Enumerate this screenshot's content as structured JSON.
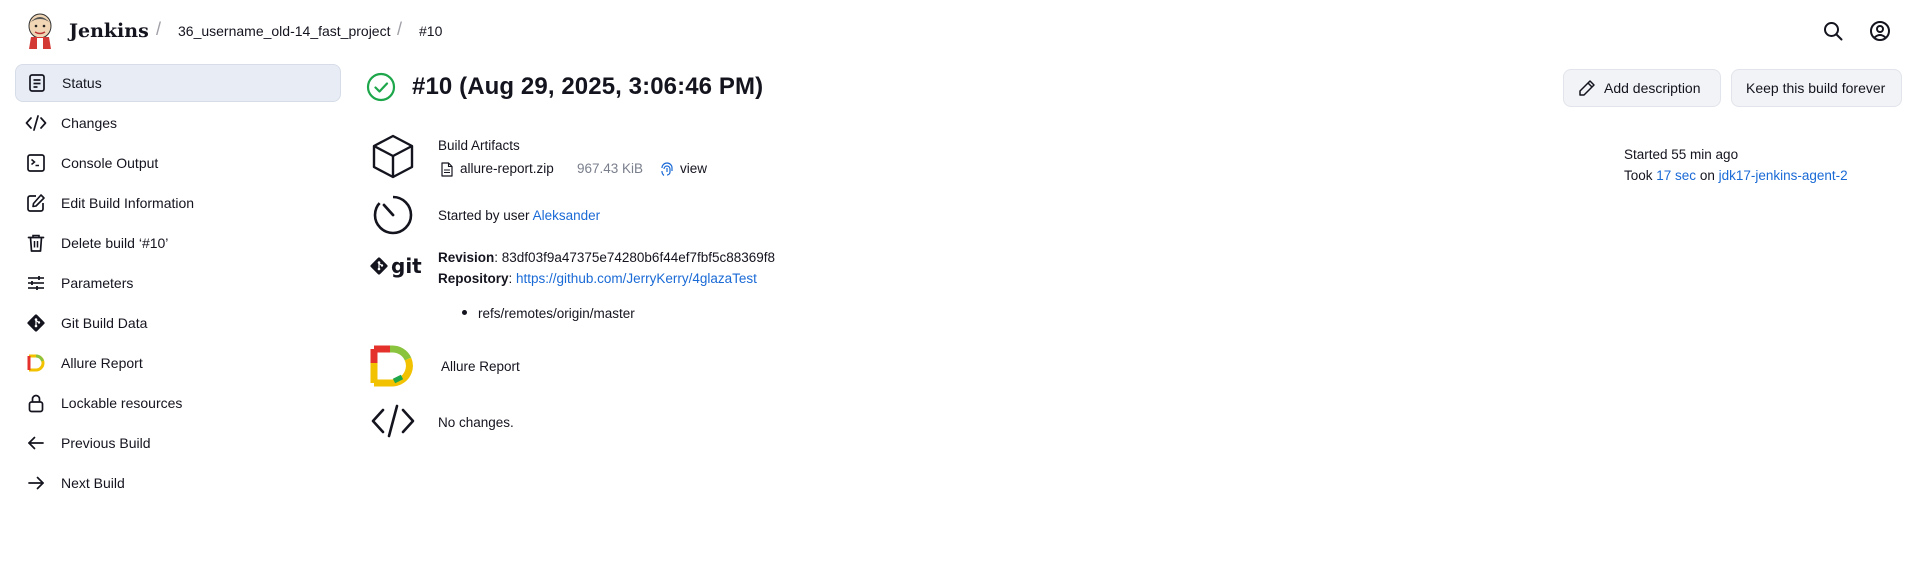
{
  "header": {
    "brand": "Jenkins",
    "breadcrumbs": [
      "36_username_old-14_fast_project",
      "#10"
    ],
    "separator": "/"
  },
  "sidebar": {
    "items": [
      {
        "label": "Status",
        "icon": "document-icon",
        "active": true
      },
      {
        "label": "Changes",
        "icon": "code-icon"
      },
      {
        "label": "Console Output",
        "icon": "terminal-icon"
      },
      {
        "label": "Edit Build Information",
        "icon": "edit-icon"
      },
      {
        "label": "Delete build ‘#10’",
        "icon": "trash-icon"
      },
      {
        "label": "Parameters",
        "icon": "sliders-icon"
      },
      {
        "label": "Git Build Data",
        "icon": "git-icon"
      },
      {
        "label": "Allure Report",
        "icon": "allure-icon"
      },
      {
        "label": "Lockable resources",
        "icon": "lock-icon"
      },
      {
        "label": "Previous Build",
        "icon": "arrow-left-icon"
      },
      {
        "label": "Next Build",
        "icon": "arrow-right-icon"
      }
    ]
  },
  "main": {
    "title": "#10 (Aug 29, 2025, 3:06:46 PM)",
    "status": "success",
    "buttons": {
      "add_description": "Add description",
      "keep_forever": "Keep this build forever"
    },
    "artifacts": {
      "heading": "Build Artifacts",
      "file_name": "allure-report.zip",
      "file_size": "967.43 KiB",
      "view_label": "view"
    },
    "started_by": {
      "prefix": "Started by user ",
      "user": "Aleksander"
    },
    "git": {
      "revision_label": "Revision",
      "revision": ": 83df03f9a47375e74280b6f44ef7fbf5c88369f8",
      "repository_label": "Repository",
      "repository_sep": ": ",
      "repository_url": "https://github.com/JerryKerry/4glazaTest",
      "refs": [
        "refs/remotes/origin/master"
      ],
      "logo_text": "git"
    },
    "allure_link": "Allure Report",
    "changes": "No changes.",
    "info": {
      "started": "Started 55 min ago",
      "took_prefix": "Took ",
      "took_duration": "17 sec",
      "on_text": " on ",
      "agent": "jdk17-jenkins-agent-2"
    }
  },
  "colors": {
    "accent": "#1a6ad6",
    "success": "#1ea64b",
    "active_bg": "#e8edf5"
  }
}
